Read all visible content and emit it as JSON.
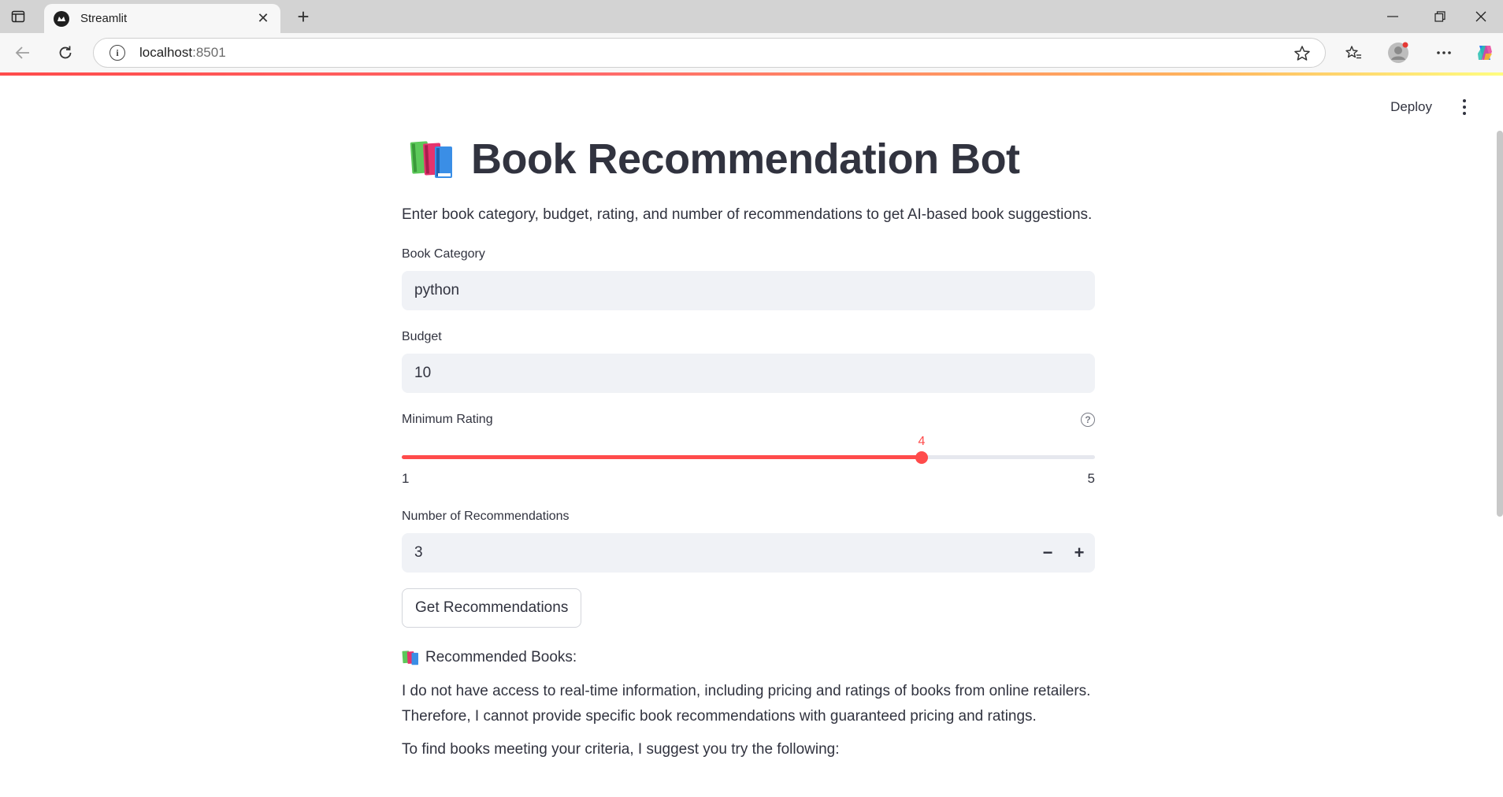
{
  "browser": {
    "tab_title": "Streamlit",
    "url_host": "localhost",
    "url_port": ":8501"
  },
  "app": {
    "deploy_label": "Deploy",
    "title": "Book Recommendation Bot",
    "title_icon": "books-emoji",
    "description": "Enter book category, budget, rating, and number of recommendations to get AI-based book suggestions."
  },
  "form": {
    "category": {
      "label": "Book Category",
      "value": "python"
    },
    "budget": {
      "label": "Budget",
      "value": "10"
    },
    "rating": {
      "label": "Minimum Rating",
      "value": "4",
      "min": "1",
      "max": "5",
      "fraction": 0.75
    },
    "count": {
      "label": "Number of Recommendations",
      "value": "3",
      "minus": "−",
      "plus": "+"
    },
    "submit_label": "Get Recommendations"
  },
  "results": {
    "heading": "Recommended Books:",
    "paragraph1_line1": "I do not have access to real-time information, including pricing and ratings of books from online retailers.",
    "paragraph1_line2": "Therefore, I cannot provide specific book recommendations with guaranteed pricing and ratings.",
    "paragraph2": "To find books meeting your criteria, I suggest you try the following:"
  },
  "colors": {
    "accent": "#ff4b4b",
    "input_bg": "#f0f2f6",
    "text": "#31333f"
  }
}
